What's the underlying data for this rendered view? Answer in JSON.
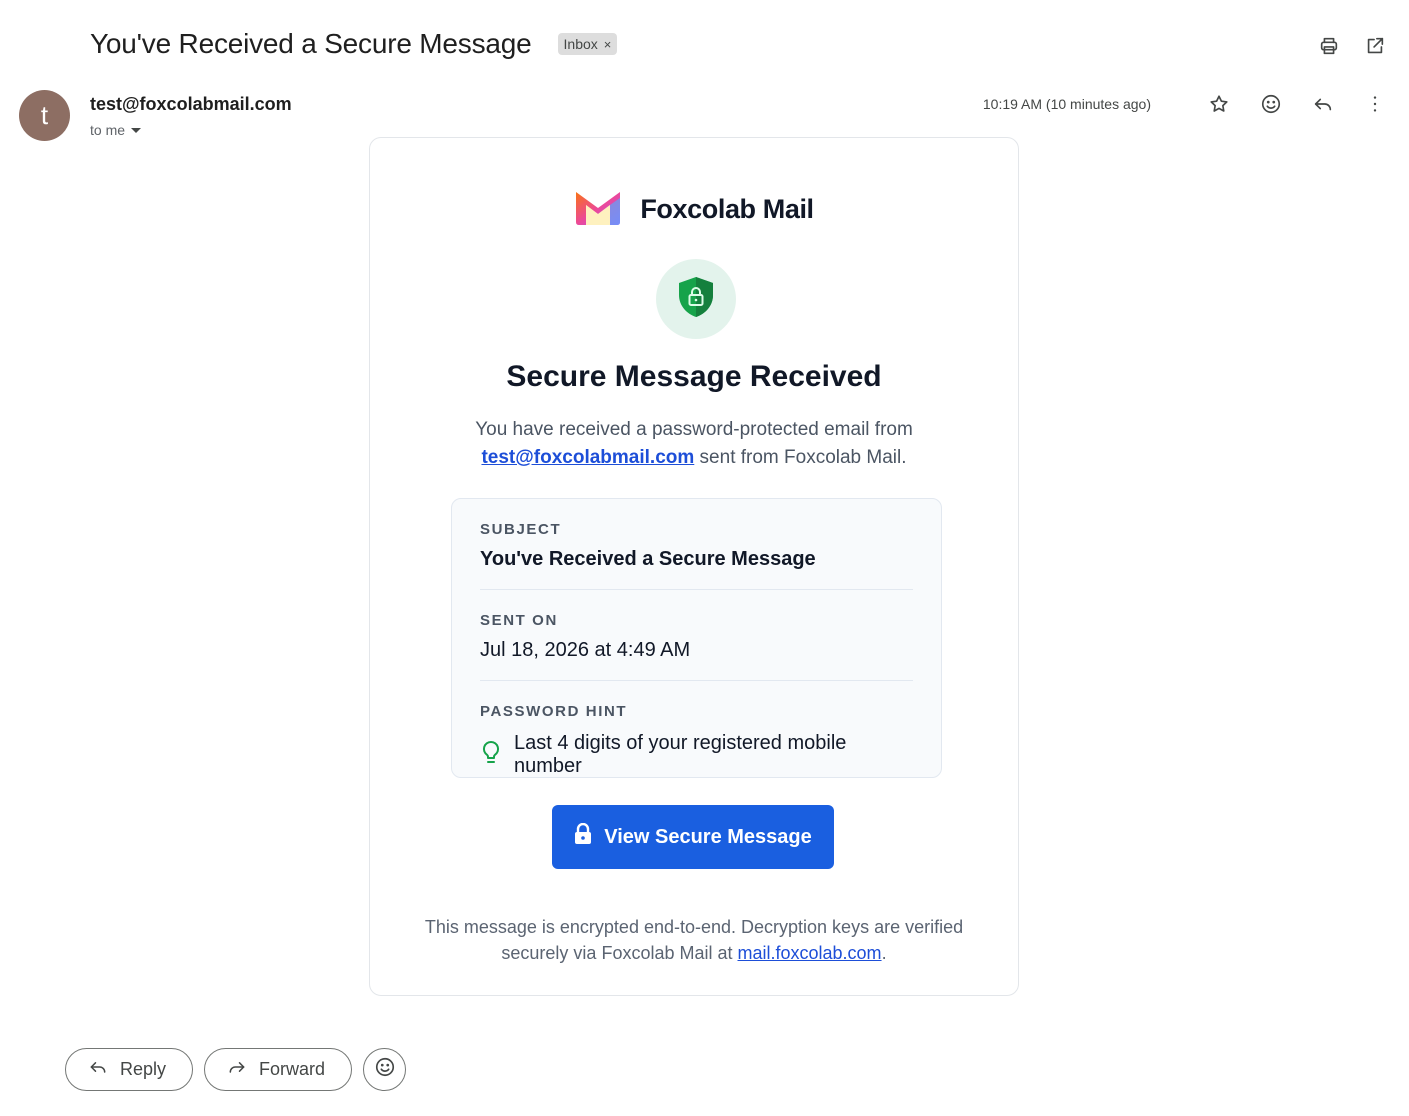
{
  "email": {
    "subject": "You've Received a Secure Message",
    "label": "Inbox",
    "label_remove": "×",
    "sender": "test@foxcolabmail.com",
    "avatar_letter": "t",
    "recipient": "to me",
    "timestamp": "10:19 AM (10 minutes ago)"
  },
  "toolbar": {
    "icons": [
      "print-icon",
      "open-in-new-window-icon",
      "star-icon",
      "emoji-icon",
      "reply-icon",
      "more-vert-icon"
    ]
  },
  "card": {
    "brand": "Foxcolab Mail",
    "heading": "Secure Message Received",
    "intro_prefix": "You have received a password-protected email from",
    "intro_link": "test@foxcolabmail.com",
    "intro_suffix": " sent from Foxcolab Mail.",
    "subject_label": "SUBJECT",
    "subject_value": "You've Received a Secure Message",
    "sent_label": "SENT ON",
    "sent_value": "Jul 18, 2026 at 4:49 AM",
    "hint_label": "PASSWORD HINT",
    "hint_value": "Last 4 digits of your registered mobile number",
    "cta_label": "View Secure Message",
    "footer_prefix": "This message is encrypted end-to-end. Decryption keys are verified securely via Foxcolab Mail at ",
    "footer_link": "mail.foxcolab.com",
    "footer_suffix": "."
  },
  "actions": {
    "reply": "Reply",
    "forward": "Forward"
  },
  "colors": {
    "cta": "#1a5fe0",
    "link": "#1d4ed8",
    "shield": "#16a34a",
    "avatar": "#8d6e63"
  }
}
